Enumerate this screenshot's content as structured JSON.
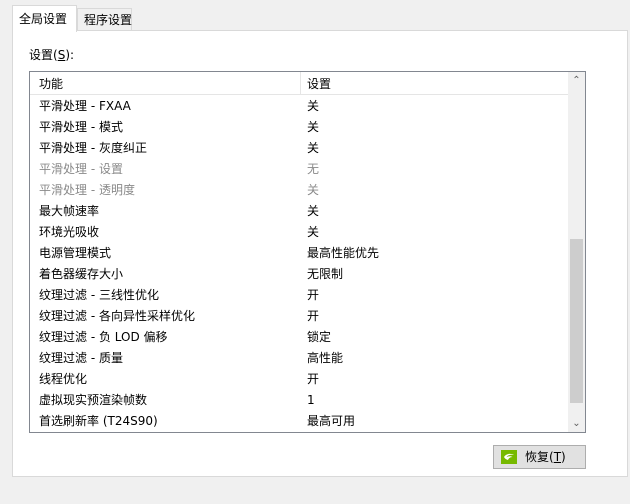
{
  "tabs": {
    "global": "全局设置",
    "program": "程序设置"
  },
  "settings_label": {
    "text": "设置(",
    "mnemonic": "S",
    "suffix": "):"
  },
  "list": {
    "headers": {
      "feature": "功能",
      "setting": "设置"
    },
    "rows": [
      {
        "feature": "平滑处理 - FXAA",
        "value": "关",
        "disabled": false
      },
      {
        "feature": "平滑处理 - 模式",
        "value": "关",
        "disabled": false
      },
      {
        "feature": "平滑处理 - 灰度纠正",
        "value": "关",
        "disabled": false
      },
      {
        "feature": "平滑处理 - 设置",
        "value": "无",
        "disabled": true
      },
      {
        "feature": "平滑处理 - 透明度",
        "value": "关",
        "disabled": true
      },
      {
        "feature": "最大帧速率",
        "value": "关",
        "disabled": false
      },
      {
        "feature": "环境光吸收",
        "value": "关",
        "disabled": false
      },
      {
        "feature": "电源管理模式",
        "value": "最高性能优先",
        "disabled": false
      },
      {
        "feature": "着色器缓存大小",
        "value": "无限制",
        "disabled": false
      },
      {
        "feature": "纹理过滤 - 三线性优化",
        "value": "开",
        "disabled": false
      },
      {
        "feature": "纹理过滤 - 各向异性采样优化",
        "value": "开",
        "disabled": false
      },
      {
        "feature": "纹理过滤 - 负 LOD 偏移",
        "value": "锁定",
        "disabled": false
      },
      {
        "feature": "纹理过滤 - 质量",
        "value": "高性能",
        "disabled": false
      },
      {
        "feature": "线程优化",
        "value": "开",
        "disabled": false
      },
      {
        "feature": "虚拟现实预渲染帧数",
        "value": "1",
        "disabled": false
      },
      {
        "feature": "首选刷新率 (T24S90)",
        "value": "最高可用",
        "disabled": false
      }
    ]
  },
  "restore_button": {
    "label": "恢复(",
    "mnemonic": "T",
    "suffix": ")",
    "icon": "nvidia-logo-icon"
  },
  "colors": {
    "panel_bg": "#ffffff",
    "window_bg": "#f0f0f0",
    "disabled_text": "#8a8a8a",
    "nvidia_green": "#76b900"
  }
}
